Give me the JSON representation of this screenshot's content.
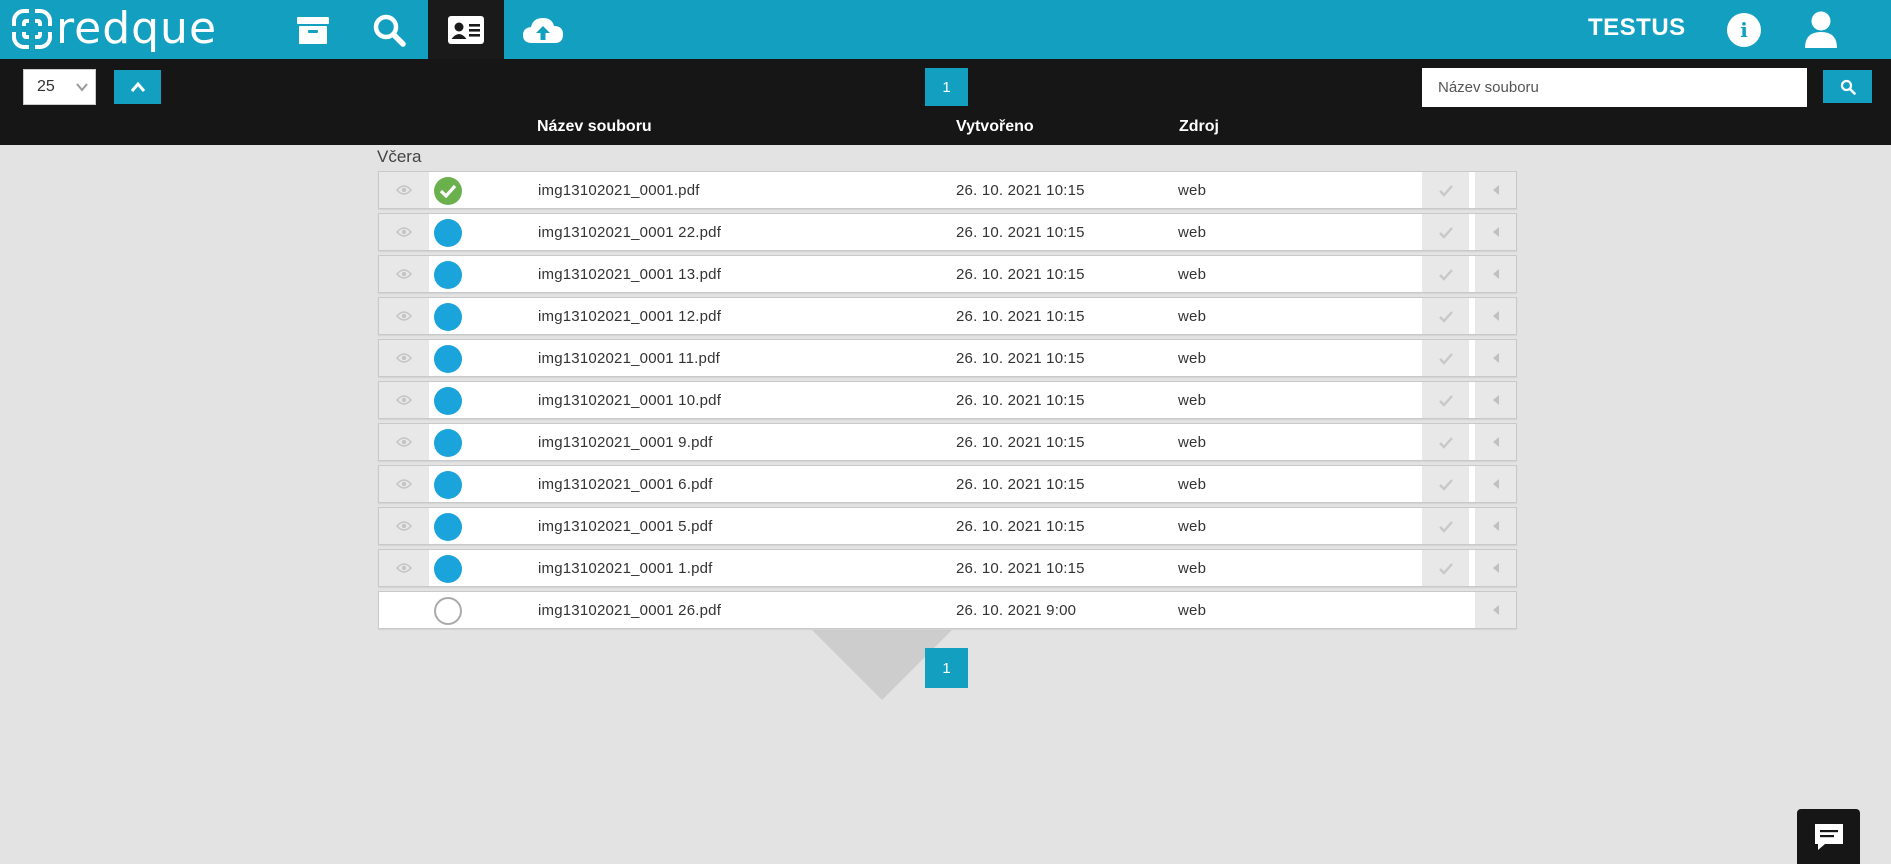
{
  "brand": {
    "name": "redque",
    "user": "TESTUS"
  },
  "nav": {
    "items": [
      {
        "icon": "archive-icon"
      },
      {
        "icon": "search-icon"
      },
      {
        "icon": "id-card-icon",
        "active": true
      },
      {
        "icon": "cloud-upload-icon"
      }
    ]
  },
  "toolbar": {
    "per_page": "25",
    "page": "1",
    "search_placeholder": "Název souboru"
  },
  "columns": {
    "name": "Název souboru",
    "created": "Vytvořeno",
    "source": "Zdroj"
  },
  "group": {
    "title": "Včera"
  },
  "rows": [
    {
      "name": "img13102021_0001.pdf",
      "created": "26. 10. 2021 10:15",
      "source": "web",
      "status": "done"
    },
    {
      "name": "img13102021_0001 22.pdf",
      "created": "26. 10. 2021 10:15",
      "source": "web",
      "status": "pending"
    },
    {
      "name": "img13102021_0001 13.pdf",
      "created": "26. 10. 2021 10:15",
      "source": "web",
      "status": "pending"
    },
    {
      "name": "img13102021_0001 12.pdf",
      "created": "26. 10. 2021 10:15",
      "source": "web",
      "status": "pending"
    },
    {
      "name": "img13102021_0001 11.pdf",
      "created": "26. 10. 2021 10:15",
      "source": "web",
      "status": "pending"
    },
    {
      "name": "img13102021_0001 10.pdf",
      "created": "26. 10. 2021 10:15",
      "source": "web",
      "status": "pending"
    },
    {
      "name": "img13102021_0001 9.pdf",
      "created": "26. 10. 2021 10:15",
      "source": "web",
      "status": "pending"
    },
    {
      "name": "img13102021_0001 6.pdf",
      "created": "26. 10. 2021 10:15",
      "source": "web",
      "status": "pending"
    },
    {
      "name": "img13102021_0001 5.pdf",
      "created": "26. 10. 2021 10:15",
      "source": "web",
      "status": "pending"
    },
    {
      "name": "img13102021_0001 1.pdf",
      "created": "26. 10. 2021 10:15",
      "source": "web",
      "status": "pending"
    },
    {
      "name": "img13102021_0001 26.pdf",
      "created": "26. 10. 2021 9:00",
      "source": "web",
      "status": "empty"
    }
  ],
  "pager_bottom": "1",
  "colors": {
    "accent": "#13a0c0",
    "dark": "#161616",
    "done": "#6ab04c",
    "pending": "#1ba3dc"
  }
}
